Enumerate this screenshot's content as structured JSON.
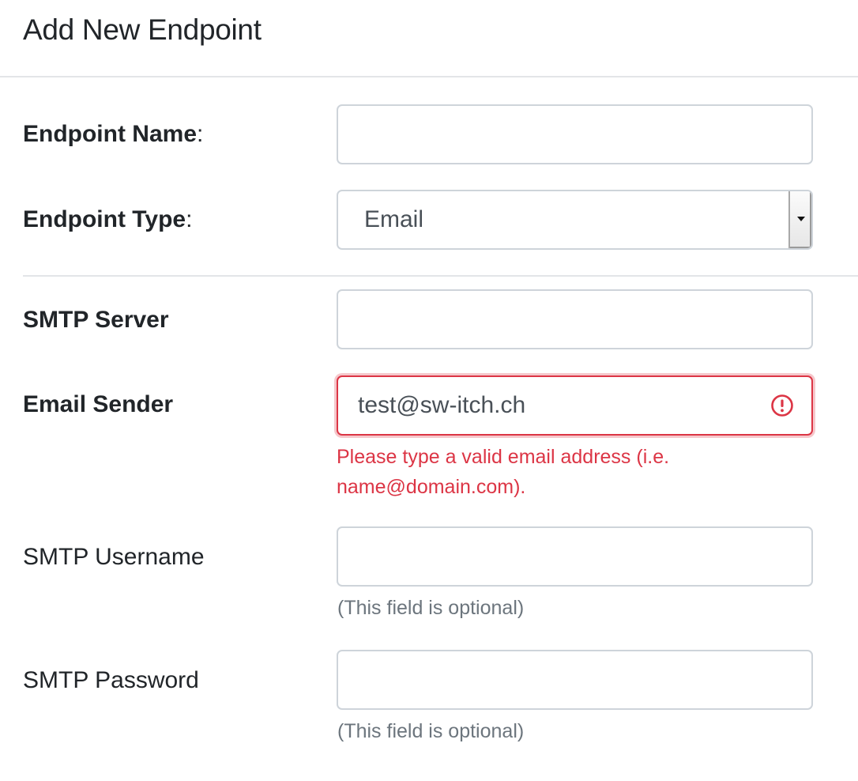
{
  "header": {
    "title": "Add New Endpoint"
  },
  "form": {
    "endpoint_name": {
      "label": "Endpoint Name",
      "suffix": ":",
      "value": "",
      "placeholder": ""
    },
    "endpoint_type": {
      "label": "Endpoint Type",
      "suffix": ":",
      "selected": "Email"
    },
    "smtp_server": {
      "label": "SMTP Server",
      "value": ""
    },
    "email_sender": {
      "label": "Email Sender",
      "value": "test@sw-itch.ch",
      "error": "Please type a valid email address (i.e. name@domain.com)."
    },
    "smtp_username": {
      "label": "SMTP Username",
      "value": "",
      "help": "(This field is optional)"
    },
    "smtp_password": {
      "label": "SMTP Password",
      "value": "",
      "help": "(This field is optional)"
    }
  },
  "icons": {
    "error": "exclamation-circle-icon",
    "select": "caret-down-icon"
  },
  "colors": {
    "error": "#dc3545",
    "border": "#ced4da",
    "muted": "#6c757d",
    "text": "#212529"
  }
}
